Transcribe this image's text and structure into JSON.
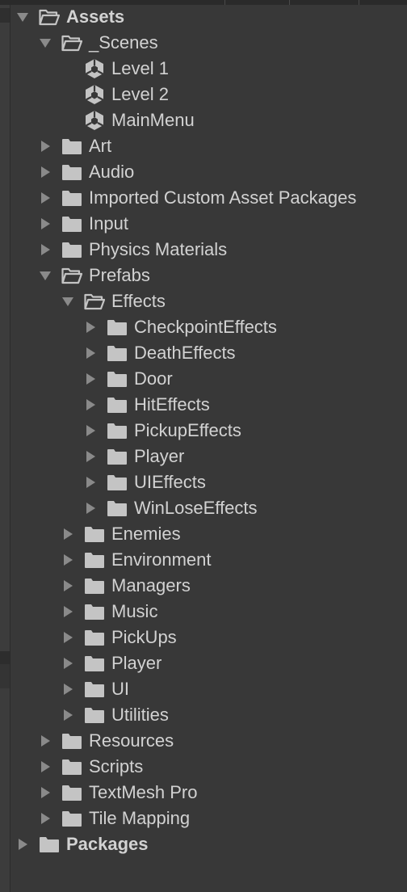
{
  "tree": [
    {
      "label": "Assets",
      "depth": 0,
      "kind": "folder",
      "state": "open",
      "bold": true
    },
    {
      "label": "_Scenes",
      "depth": 1,
      "kind": "folder",
      "state": "open",
      "bold": false
    },
    {
      "label": "Level 1",
      "depth": 2,
      "kind": "scene",
      "state": "none",
      "bold": false
    },
    {
      "label": "Level 2",
      "depth": 2,
      "kind": "scene",
      "state": "none",
      "bold": false
    },
    {
      "label": "MainMenu",
      "depth": 2,
      "kind": "scene",
      "state": "none",
      "bold": false
    },
    {
      "label": "Art",
      "depth": 1,
      "kind": "folder",
      "state": "closed",
      "bold": false
    },
    {
      "label": "Audio",
      "depth": 1,
      "kind": "folder",
      "state": "closed",
      "bold": false
    },
    {
      "label": "Imported Custom Asset Packages",
      "depth": 1,
      "kind": "folder",
      "state": "closed",
      "bold": false
    },
    {
      "label": "Input",
      "depth": 1,
      "kind": "folder",
      "state": "closed",
      "bold": false
    },
    {
      "label": "Physics Materials",
      "depth": 1,
      "kind": "folder",
      "state": "closed",
      "bold": false
    },
    {
      "label": "Prefabs",
      "depth": 1,
      "kind": "folder",
      "state": "open",
      "bold": false
    },
    {
      "label": "Effects",
      "depth": 2,
      "kind": "folder",
      "state": "open",
      "bold": false
    },
    {
      "label": "CheckpointEffects",
      "depth": 3,
      "kind": "folder",
      "state": "closed",
      "bold": false
    },
    {
      "label": "DeathEffects",
      "depth": 3,
      "kind": "folder",
      "state": "closed",
      "bold": false
    },
    {
      "label": "Door",
      "depth": 3,
      "kind": "folder",
      "state": "closed",
      "bold": false
    },
    {
      "label": "HitEffects",
      "depth": 3,
      "kind": "folder",
      "state": "closed",
      "bold": false
    },
    {
      "label": "PickupEffects",
      "depth": 3,
      "kind": "folder",
      "state": "closed",
      "bold": false
    },
    {
      "label": "Player",
      "depth": 3,
      "kind": "folder",
      "state": "closed",
      "bold": false
    },
    {
      "label": "UIEffects",
      "depth": 3,
      "kind": "folder",
      "state": "closed",
      "bold": false
    },
    {
      "label": "WinLoseEffects",
      "depth": 3,
      "kind": "folder",
      "state": "closed",
      "bold": false
    },
    {
      "label": "Enemies",
      "depth": 2,
      "kind": "folder",
      "state": "closed",
      "bold": false
    },
    {
      "label": "Environment",
      "depth": 2,
      "kind": "folder",
      "state": "closed",
      "bold": false
    },
    {
      "label": "Managers",
      "depth": 2,
      "kind": "folder",
      "state": "closed",
      "bold": false
    },
    {
      "label": "Music",
      "depth": 2,
      "kind": "folder",
      "state": "closed",
      "bold": false
    },
    {
      "label": "PickUps",
      "depth": 2,
      "kind": "folder",
      "state": "closed",
      "bold": false
    },
    {
      "label": "Player",
      "depth": 2,
      "kind": "folder",
      "state": "closed",
      "bold": false
    },
    {
      "label": "UI",
      "depth": 2,
      "kind": "folder",
      "state": "closed",
      "bold": false
    },
    {
      "label": "Utilities",
      "depth": 2,
      "kind": "folder",
      "state": "closed",
      "bold": false
    },
    {
      "label": "Resources",
      "depth": 1,
      "kind": "folder",
      "state": "closed",
      "bold": false
    },
    {
      "label": "Scripts",
      "depth": 1,
      "kind": "folder",
      "state": "closed",
      "bold": false
    },
    {
      "label": "TextMesh Pro",
      "depth": 1,
      "kind": "folder",
      "state": "closed",
      "bold": false
    },
    {
      "label": "Tile Mapping",
      "depth": 1,
      "kind": "folder",
      "state": "closed",
      "bold": false
    },
    {
      "label": "Packages",
      "depth": 0,
      "kind": "folder",
      "state": "closed",
      "bold": true
    }
  ],
  "colors": {
    "background": "#383838",
    "text": "#d2d2d2",
    "icon": "#c4c4c4",
    "arrow": "#8a8a8a"
  }
}
